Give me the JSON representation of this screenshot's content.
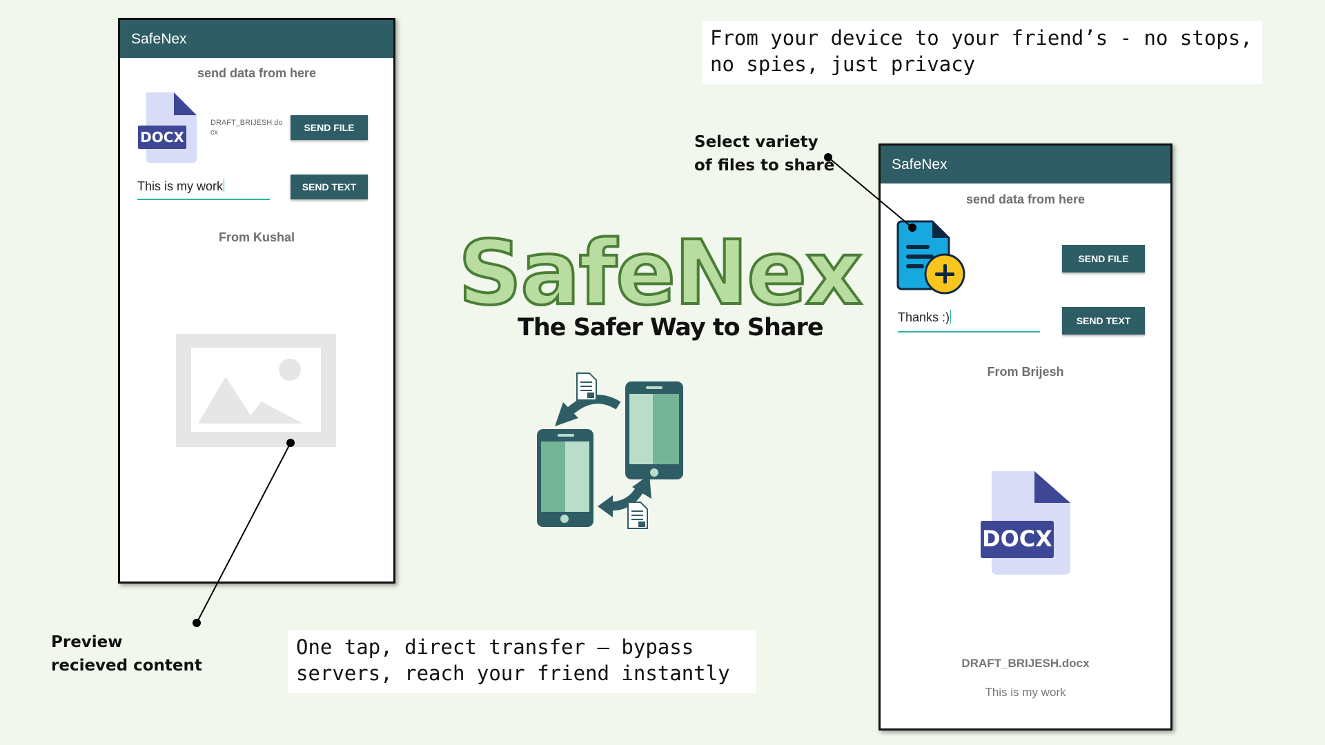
{
  "left_phone": {
    "app_title": "SafeNex",
    "subtitle": "send data from here",
    "file_badge": "DOCX",
    "file_name": "DRAFT_BRIJESH.docx",
    "send_file_label": "SEND FILE",
    "text_value": "This is my work",
    "send_text_label": "SEND TEXT",
    "from_label": "From Kushal"
  },
  "right_phone": {
    "app_title": "SafeNex",
    "subtitle": "send data from here",
    "send_file_label": "SEND FILE",
    "text_value": "Thanks :)",
    "send_text_label": "SEND TEXT",
    "from_label": "From Brijesh",
    "received_badge": "DOCX",
    "received_file_name": "DRAFT_BRIJESH.docx",
    "received_text": "This is my work"
  },
  "banner_top": "From your device to your friend’s - no stops, no spies, just privacy",
  "banner_bottom": "One tap, direct transfer – bypass servers, reach your friend instantly",
  "logo": {
    "title": "SafeNex",
    "tagline": "The Safer Way to Share"
  },
  "annotations": {
    "select_files": "Select variety of files to share",
    "preview": "Preview recieved content"
  },
  "colors": {
    "background": "#f1f7ec",
    "app_bar": "#2f5d65",
    "accent": "#2bb3a0",
    "logo_fill": "#b9dca1",
    "logo_stroke": "#4a7e36"
  },
  "icons": [
    "docx-file-icon",
    "image-placeholder-icon",
    "add-file-icon",
    "phone-transfer-icon"
  ]
}
